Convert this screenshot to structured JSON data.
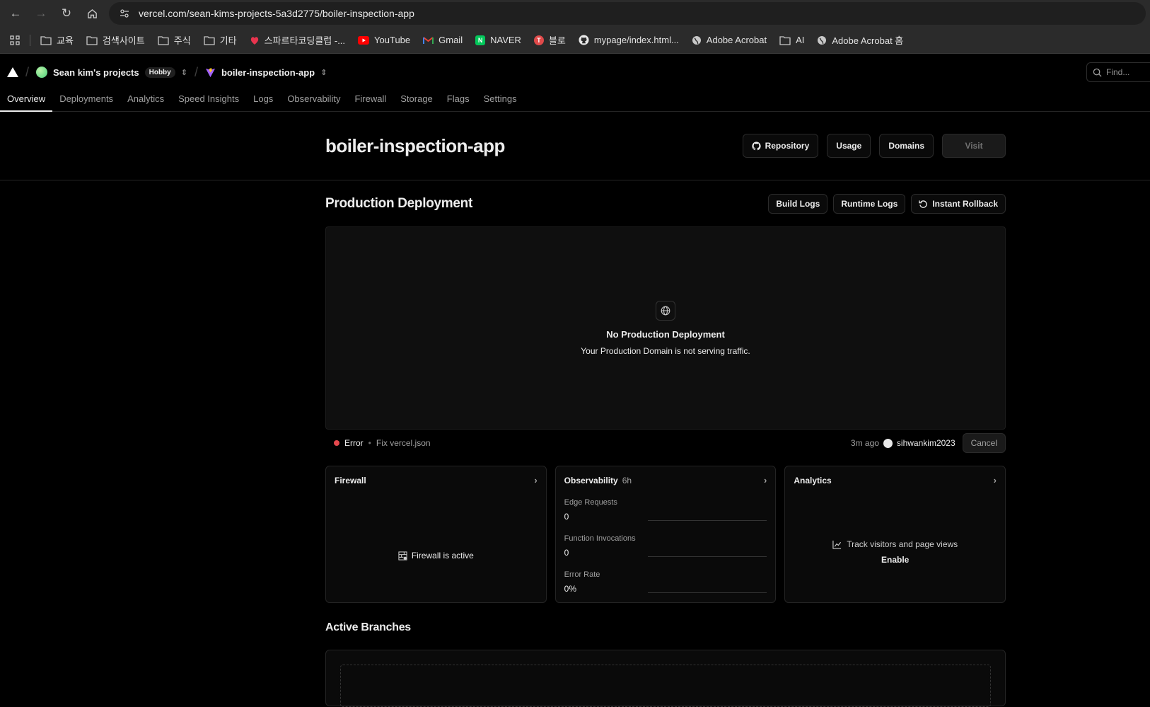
{
  "browser": {
    "url": "vercel.com/sean-kims-projects-5a3d2775/boiler-inspection-app",
    "bookmarks": [
      {
        "label": "교육",
        "icon": "folder-icon"
      },
      {
        "label": "검색사이트",
        "icon": "folder-icon"
      },
      {
        "label": "주식",
        "icon": "folder-icon"
      },
      {
        "label": "기타",
        "icon": "folder-icon"
      },
      {
        "label": "스파르타코딩클럽 -...",
        "icon": "sparta-icon"
      },
      {
        "label": "YouTube",
        "icon": "youtube-icon"
      },
      {
        "label": "Gmail",
        "icon": "gmail-icon"
      },
      {
        "label": "NAVER",
        "icon": "naver-icon"
      },
      {
        "label": "블로",
        "icon": "blog-icon"
      },
      {
        "label": "mypage/index.html...",
        "icon": "github-icon"
      },
      {
        "label": "Adobe Acrobat",
        "icon": "globe-icon"
      },
      {
        "label": "AI",
        "icon": "folder-icon"
      },
      {
        "label": "Adobe Acrobat 홈",
        "icon": "globe-icon"
      }
    ]
  },
  "header": {
    "team": "Sean kim's projects",
    "plan_badge": "Hobby",
    "project": "boiler-inspection-app",
    "find_placeholder": "Find..."
  },
  "tabs": [
    "Overview",
    "Deployments",
    "Analytics",
    "Speed Insights",
    "Logs",
    "Observability",
    "Firewall",
    "Storage",
    "Flags",
    "Settings"
  ],
  "project": {
    "title": "boiler-inspection-app",
    "actions": {
      "repository": "Repository",
      "usage": "Usage",
      "domains": "Domains",
      "visit": "Visit"
    }
  },
  "production": {
    "title": "Production Deployment",
    "actions": {
      "build_logs": "Build Logs",
      "runtime_logs": "Runtime Logs",
      "instant_rollback": "Instant Rollback"
    },
    "empty_title": "No Production Deployment",
    "empty_subtitle": "Your Production Domain is not serving traffic.",
    "status": "Error",
    "commit": "Fix vercel.json",
    "time_ago": "3m ago",
    "user": "sihwankim2023",
    "cancel": "Cancel"
  },
  "cards": {
    "firewall": {
      "title": "Firewall",
      "status": "Firewall is active"
    },
    "observability": {
      "title": "Observability",
      "period": "6h",
      "metrics": [
        {
          "label": "Edge Requests",
          "value": "0"
        },
        {
          "label": "Function Invocations",
          "value": "0"
        },
        {
          "label": "Error Rate",
          "value": "0%"
        }
      ]
    },
    "analytics": {
      "title": "Analytics",
      "cta_text": "Track visitors and page views",
      "cta_action": "Enable"
    }
  },
  "active_branches": {
    "title": "Active Branches"
  },
  "colors": {
    "error": "#e5484d",
    "background": "#000000",
    "accent_text": "#ededed"
  }
}
